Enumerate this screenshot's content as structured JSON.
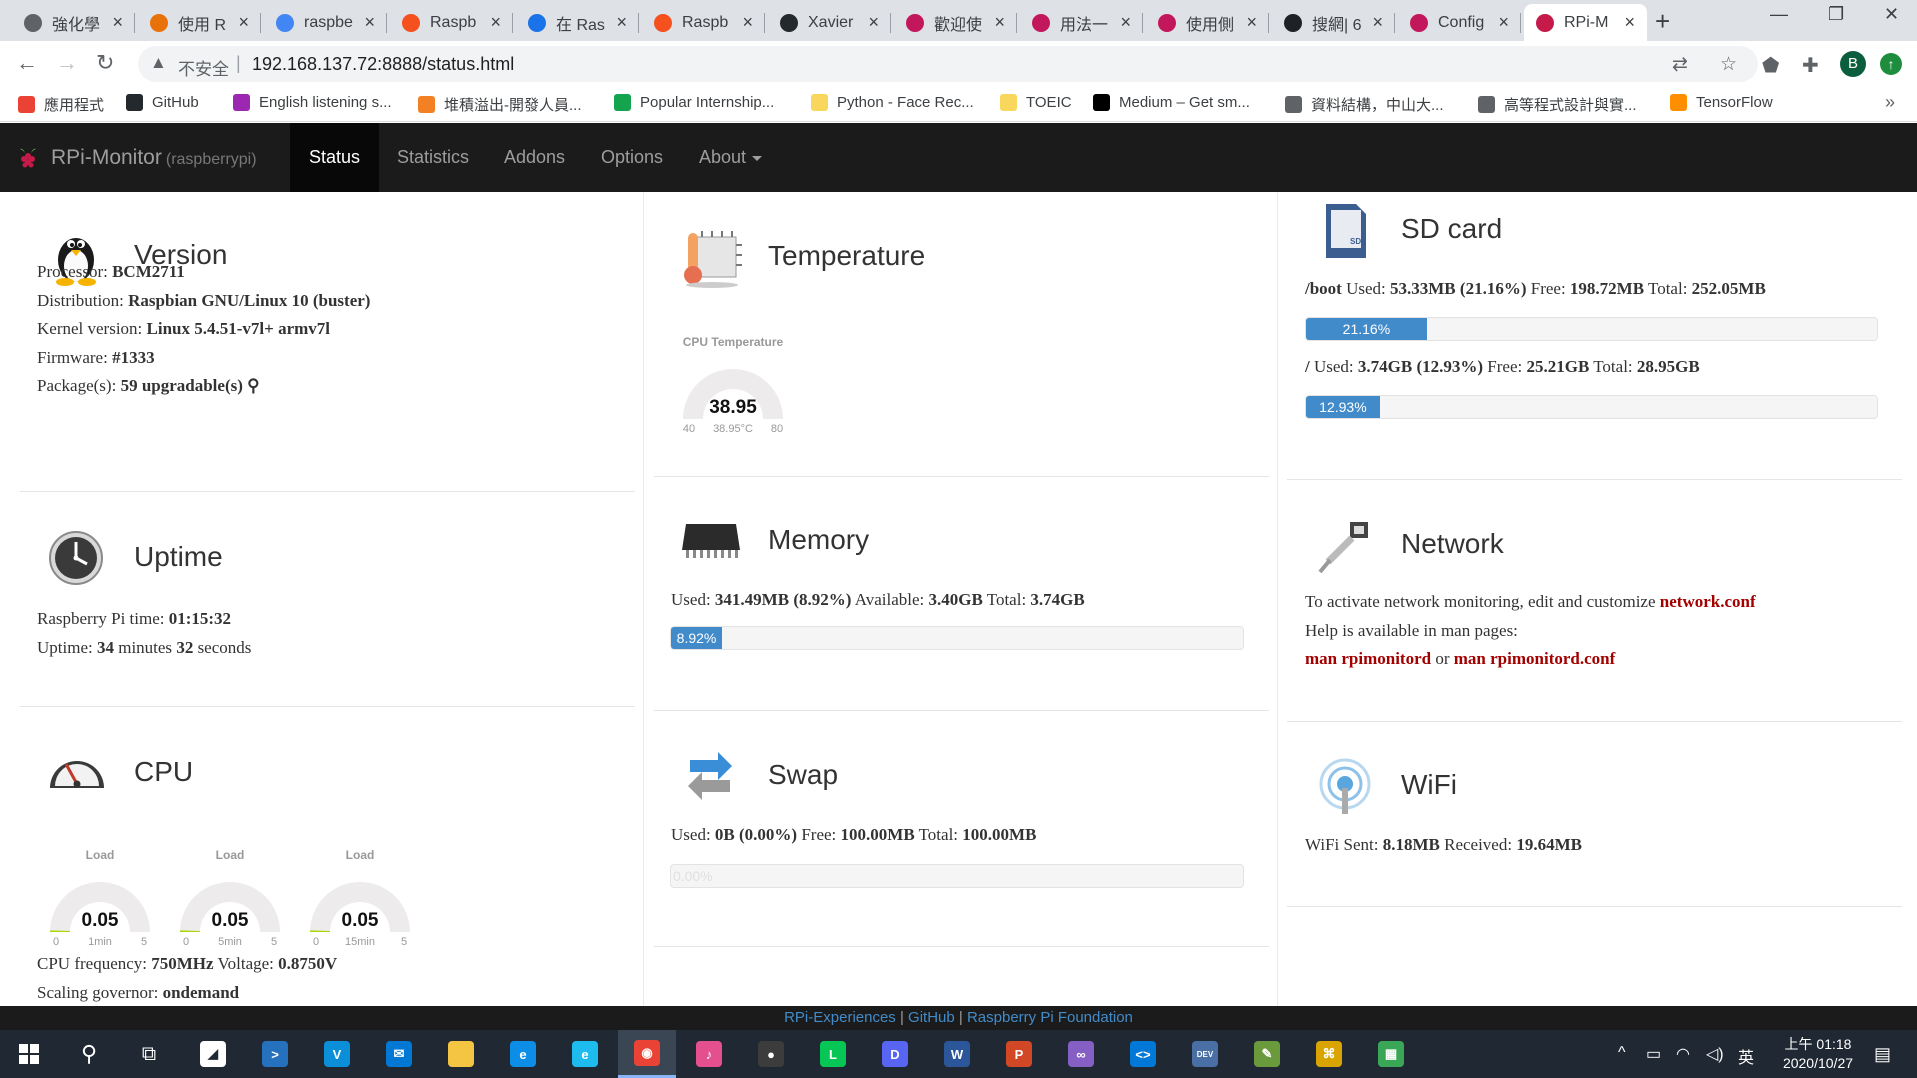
{
  "browser": {
    "tabs": [
      {
        "label": "強化學",
        "color": "#5f6368",
        "icon": "chrome-icon"
      },
      {
        "label": "使用 R",
        "color": "#e8710a",
        "icon": "doc-icon"
      },
      {
        "label": "raspbe",
        "color": "#4285f4",
        "icon": "google-icon"
      },
      {
        "label": "Raspb",
        "color": "#f4511e",
        "icon": "blogger-icon"
      },
      {
        "label": "在 Ras",
        "color": "#1a73e8",
        "icon": "site-icon"
      },
      {
        "label": "Raspb",
        "color": "#f4511e",
        "icon": "blogger-icon"
      },
      {
        "label": "Xavier",
        "color": "#24292e",
        "icon": "github-icon"
      },
      {
        "label": "歡迎使",
        "color": "#c2185b",
        "icon": "site-icon"
      },
      {
        "label": "用法一",
        "color": "#c2185b",
        "icon": "site-icon"
      },
      {
        "label": "使用側",
        "color": "#c2185b",
        "icon": "site-icon"
      },
      {
        "label": "搜網| 6",
        "color": "#202124",
        "icon": "star-icon"
      },
      {
        "label": "Config",
        "color": "#c2185b",
        "icon": "site-icon"
      },
      {
        "label": "RPi-M",
        "color": "#c51a4a",
        "icon": "raspberry-icon"
      }
    ],
    "address": {
      "insecure_label": "不安全",
      "url": "192.168.137.72:8888/status.html"
    },
    "profile_initial": "B",
    "bookmarks": [
      {
        "label": "應用程式",
        "color": "#ea4335",
        "icon": "apps-icon"
      },
      {
        "label": "GitHub",
        "color": "#24292e",
        "icon": "github-icon"
      },
      {
        "label": "English listening s...",
        "color": "#9c27b0",
        "icon": "site-icon"
      },
      {
        "label": "堆積溢出-開發人員...",
        "color": "#f48024",
        "icon": "stackoverflow-icon"
      },
      {
        "label": "Popular Internship...",
        "color": "#14a44d",
        "icon": "site-icon"
      },
      {
        "label": "Python - Face Rec...",
        "color": "#f9d65c",
        "icon": "folder-icon"
      },
      {
        "label": "TOEIC",
        "color": "#f9d65c",
        "icon": "folder-icon"
      },
      {
        "label": "Medium – Get sm...",
        "color": "#000000",
        "icon": "medium-icon"
      },
      {
        "label": "資料結構，中山大...",
        "color": "#5f6368",
        "icon": "globe-icon"
      },
      {
        "label": "高等程式設計與實...",
        "color": "#5f6368",
        "icon": "globe-icon"
      },
      {
        "label": "TensorFlow",
        "color": "#ff8f00",
        "icon": "tensorflow-icon"
      }
    ]
  },
  "navbar": {
    "brand": "RPi-Monitor",
    "hostname": "(raspberrypi)",
    "items": [
      "Status",
      "Statistics",
      "Addons",
      "Options",
      "About"
    ]
  },
  "version": {
    "title": "Version",
    "rows": [
      {
        "label": "Processor: ",
        "value": "BCM2711"
      },
      {
        "label": "Distribution: ",
        "value": "Raspbian GNU/Linux 10 (buster)"
      },
      {
        "label": "Kernel version: ",
        "value": "Linux 5.4.51-v7l+ armv7l"
      },
      {
        "label": "Firmware: ",
        "value": "#1333"
      },
      {
        "label": "Package(s): ",
        "value": "59 upgradable(s)"
      }
    ]
  },
  "uptime": {
    "title": "Uptime",
    "pi_time_label": "Raspberry Pi time: ",
    "pi_time": "01:15:32",
    "uptime_label": "Uptime: ",
    "minutes": "34",
    "minutes_label": " minutes ",
    "seconds": "32",
    "seconds_label": " seconds"
  },
  "cpu": {
    "title": "CPU",
    "gauges": [
      {
        "title": "Load",
        "value": "0.05",
        "fraction": 0.01,
        "min": "0",
        "max": "5",
        "caption": "1min"
      },
      {
        "title": "Load",
        "value": "0.05",
        "fraction": 0.01,
        "min": "0",
        "max": "5",
        "caption": "5min"
      },
      {
        "title": "Load",
        "value": "0.05",
        "fraction": 0.01,
        "min": "0",
        "max": "5",
        "caption": "15min"
      }
    ],
    "freq_label": "CPU frequency: ",
    "freq": "750MHz",
    "voltage_label": " Voltage: ",
    "voltage": "0.8750V",
    "governor_label": "Scaling governor: ",
    "governor": "ondemand"
  },
  "temperature": {
    "title": "Temperature",
    "gauge": {
      "title": "CPU Temperature",
      "value": "38.95",
      "fraction": 0.0,
      "min": "40",
      "max": "80",
      "caption": "38.95°C"
    }
  },
  "memory": {
    "title": "Memory",
    "used_label": "Used: ",
    "used": "341.49MB",
    "used_pct": "(8.92%)",
    "available_label": " Available: ",
    "available": "3.40GB",
    "total_label": " Total: ",
    "total": "3.74GB",
    "bar_label": "8.92%",
    "bar_fraction": 0.0892
  },
  "swap": {
    "title": "Swap",
    "used_label": "Used: ",
    "used": "0B",
    "used_pct": "(0.00%)",
    "free_label": " Free: ",
    "free": "100.00MB",
    "total_label": " Total: ",
    "total": "100.00MB",
    "bar_label": "0.00%",
    "bar_fraction": 0.0
  },
  "sdcard": {
    "title": "SD card",
    "boot": {
      "mount": "/boot",
      "used_label": " Used: ",
      "used": "53.33MB",
      "used_pct": "(21.16%)",
      "free_label": " Free: ",
      "free": "198.72MB",
      "total_label": " Total: ",
      "total": "252.05MB",
      "bar_label": "21.16%",
      "bar_fraction": 0.2116
    },
    "root": {
      "mount": "/",
      "used_label": " Used: ",
      "used": "3.74GB",
      "used_pct": "(12.93%)",
      "free_label": " Free: ",
      "free": "25.21GB",
      "total_label": " Total: ",
      "total": "28.95GB",
      "bar_label": "12.93%",
      "bar_fraction": 0.1293
    }
  },
  "network": {
    "title": "Network",
    "line1": "To activate network monitoring, edit and customize ",
    "config_file": "network.conf",
    "line2": "Help is available in man pages:",
    "man1": "man rpimonitord",
    "or_label": " or ",
    "man2": "man rpimonitord.conf"
  },
  "wifi": {
    "title": "WiFi",
    "sent_label": "WiFi Sent: ",
    "sent": "8.18MB",
    "received_label": " Received: ",
    "received": "19.64MB"
  },
  "footer": {
    "link1": "RPi-Experiences",
    "sep1": " | ",
    "link2": "GitHub",
    "sep2": " | ",
    "link3": "Raspberry Pi Foundation"
  },
  "taskbar": {
    "apps": [
      {
        "name": "cortana-app",
        "icon": "cortana-icon",
        "color": "#ffffff",
        "glyph": "◢"
      },
      {
        "name": "powershell-app",
        "icon": "powershell-icon",
        "color": "#2671be",
        "glyph": ">"
      },
      {
        "name": "vnc-app",
        "icon": "vnc-icon",
        "color": "#0a8fd8",
        "glyph": "V"
      },
      {
        "name": "mail-app",
        "icon": "mail-icon",
        "color": "#0078d4",
        "glyph": "✉"
      },
      {
        "name": "explorer-app",
        "icon": "folder-icon",
        "color": "#f4c542",
        "glyph": ""
      },
      {
        "name": "edge-app",
        "icon": "edge-icon",
        "color": "#0c8ee6",
        "glyph": "e"
      },
      {
        "name": "ie-app",
        "icon": "ie-icon",
        "color": "#1ebbee",
        "glyph": "e"
      },
      {
        "name": "chrome-app",
        "icon": "chrome-icon",
        "color": "#ea4335",
        "glyph": "◉"
      },
      {
        "name": "itunes-app",
        "icon": "itunes-icon",
        "color": "#e4508e",
        "glyph": "♪"
      },
      {
        "name": "obs-app",
        "icon": "obs-icon",
        "color": "#3c3c3c",
        "glyph": "●"
      },
      {
        "name": "line-app",
        "icon": "line-icon",
        "color": "#06c755",
        "glyph": "L"
      },
      {
        "name": "discord-app",
        "icon": "discord-icon",
        "color": "#5865f2",
        "glyph": "D"
      },
      {
        "name": "word-app",
        "icon": "word-icon",
        "color": "#2b579a",
        "glyph": "W"
      },
      {
        "name": "powerpoint-app",
        "icon": "powerpoint-icon",
        "color": "#d24726",
        "glyph": "P"
      },
      {
        "name": "visualstudio-app",
        "icon": "visual-studio-icon",
        "color": "#865fc5",
        "glyph": "∞"
      },
      {
        "name": "vscode-app",
        "icon": "vscode-icon",
        "color": "#0078d7",
        "glyph": "<>"
      },
      {
        "name": "devcpp-app",
        "icon": "devcpp-icon",
        "color": "#4a6fa5",
        "glyph": "DEV"
      },
      {
        "name": "notepad-app",
        "icon": "notepad-icon",
        "color": "#6a9a3c",
        "glyph": "✎"
      },
      {
        "name": "network-tool-app",
        "icon": "network-tool-icon",
        "color": "#d9a400",
        "glyph": "⌘"
      },
      {
        "name": "store-app",
        "icon": "store-icon",
        "color": "#3aa757",
        "glyph": "▦"
      }
    ],
    "ime": "英",
    "time": "上午 01:18",
    "date": "2020/10/27"
  }
}
